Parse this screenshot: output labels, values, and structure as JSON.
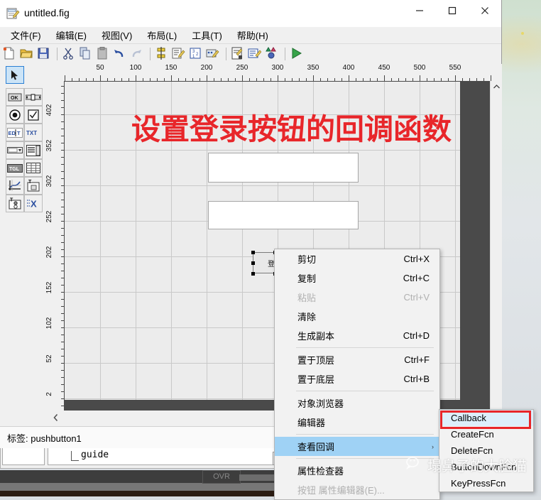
{
  "window": {
    "title": "untitled.fig",
    "icon": "fig-document-icon",
    "controls": {
      "minimize": "minimize-icon",
      "maximize": "maximize-icon",
      "close": "close-icon"
    }
  },
  "menubar": {
    "items": [
      {
        "label": "文件(F)",
        "name": "menu-file"
      },
      {
        "label": "编辑(E)",
        "name": "menu-edit"
      },
      {
        "label": "视图(V)",
        "name": "menu-view"
      },
      {
        "label": "布局(L)",
        "name": "menu-layout"
      },
      {
        "label": "工具(T)",
        "name": "menu-tools"
      },
      {
        "label": "帮助(H)",
        "name": "menu-help"
      }
    ]
  },
  "toolbar": {
    "items": [
      "new-file-icon",
      "open-folder-icon",
      "save-disk-icon",
      "sep",
      "cut-scissors-icon",
      "copy-icon",
      "paste-icon",
      "undo-arrow-icon",
      "redo-arrow-icon",
      "sep",
      "align-objects-icon",
      "menu-editor-icon",
      "tab-order-editor-icon",
      "toolbar-editor-icon",
      "sep",
      "m-file-editor-icon",
      "property-inspector-icon",
      "object-browser-icon",
      "sep",
      "run-figure-icon"
    ]
  },
  "palette": {
    "tools": [
      {
        "name": "select-arrow-tool",
        "glyph": "arrow",
        "selected": true
      },
      {
        "name": "push-button-tool",
        "glyph": "OK",
        "selected": false
      },
      {
        "name": "slider-tool",
        "glyph": "slider",
        "selected": false
      },
      {
        "name": "radio-button-tool",
        "glyph": "radio",
        "selected": false
      },
      {
        "name": "check-box-tool",
        "glyph": "check",
        "selected": false
      },
      {
        "name": "edit-text-tool",
        "glyph": "EDIT",
        "selected": false
      },
      {
        "name": "static-text-tool",
        "glyph": "TXT",
        "selected": false
      },
      {
        "name": "pop-up-menu-tool",
        "glyph": "popup",
        "selected": false
      },
      {
        "name": "list-box-tool",
        "glyph": "listbox",
        "selected": false
      },
      {
        "name": "toggle-button-tool",
        "glyph": "TGL",
        "selected": false
      },
      {
        "name": "table-tool",
        "glyph": "table",
        "selected": false
      },
      {
        "name": "axes-tool",
        "glyph": "axes",
        "selected": false
      },
      {
        "name": "panel-tool",
        "glyph": "panel",
        "selected": false
      },
      {
        "name": "button-group-tool",
        "glyph": "buttongroup",
        "selected": false
      },
      {
        "name": "activex-control-tool",
        "glyph": "activex",
        "selected": false
      }
    ]
  },
  "rulers": {
    "horizontal": [
      "50",
      "100",
      "150",
      "200",
      "250",
      "300",
      "350",
      "400",
      "450",
      "500",
      "550"
    ],
    "vertical": [
      "402",
      "352",
      "302",
      "252",
      "202",
      "152",
      "102",
      "52",
      "2"
    ]
  },
  "canvas": {
    "annotation": "设置登录按钮的回调函数",
    "annotation_color": "#e8262a",
    "push_button_label": "登录",
    "edit_boxes": 2
  },
  "context_menu": {
    "items": [
      {
        "label": "剪切",
        "accel": "Ctrl+X",
        "disabled": false,
        "submenu": false,
        "highlighted": false,
        "name": "ctx-cut"
      },
      {
        "label": "复制",
        "accel": "Ctrl+C",
        "disabled": false,
        "submenu": false,
        "highlighted": false,
        "name": "ctx-copy"
      },
      {
        "label": "粘贴",
        "accel": "Ctrl+V",
        "disabled": true,
        "submenu": false,
        "highlighted": false,
        "name": "ctx-paste"
      },
      {
        "label": "清除",
        "accel": "",
        "disabled": false,
        "submenu": false,
        "highlighted": false,
        "name": "ctx-clear"
      },
      {
        "label": "生成副本",
        "accel": "Ctrl+D",
        "disabled": false,
        "submenu": false,
        "highlighted": false,
        "name": "ctx-duplicate"
      },
      {
        "separator": true
      },
      {
        "label": "置于顶层",
        "accel": "Ctrl+F",
        "disabled": false,
        "submenu": false,
        "highlighted": false,
        "name": "ctx-bring-to-front"
      },
      {
        "label": "置于底层",
        "accel": "Ctrl+B",
        "disabled": false,
        "submenu": false,
        "highlighted": false,
        "name": "ctx-send-to-back"
      },
      {
        "separator": true
      },
      {
        "label": "对象浏览器",
        "accel": "",
        "disabled": false,
        "submenu": false,
        "highlighted": false,
        "name": "ctx-object-browser"
      },
      {
        "label": "编辑器",
        "accel": "",
        "disabled": false,
        "submenu": false,
        "highlighted": false,
        "name": "ctx-editor"
      },
      {
        "separator": true
      },
      {
        "label": "查看回调",
        "accel": "",
        "disabled": false,
        "submenu": true,
        "highlighted": true,
        "name": "ctx-view-callbacks"
      },
      {
        "separator": true
      },
      {
        "label": "属性检查器",
        "accel": "",
        "disabled": false,
        "submenu": false,
        "highlighted": false,
        "name": "ctx-property-inspector"
      },
      {
        "label": "按钮 属性编辑器(E)...",
        "accel": "",
        "disabled": true,
        "submenu": false,
        "highlighted": false,
        "name": "ctx-button-property-editor"
      }
    ]
  },
  "submenu": {
    "items": [
      {
        "label": "Callback",
        "highlighted": true,
        "name": "submenu-callback"
      },
      {
        "label": "CreateFcn",
        "highlighted": false,
        "name": "submenu-createfcn"
      },
      {
        "label": "DeleteFcn",
        "highlighted": false,
        "name": "submenu-deletefcn"
      },
      {
        "label": "ButtonDownFcn",
        "highlighted": false,
        "name": "submenu-buttondownfcn"
      },
      {
        "label": "KeyPressFcn",
        "highlighted": false,
        "name": "submenu-keypressfcn"
      }
    ],
    "highlight_box_color": "#e8262a"
  },
  "statusbar": {
    "text": "标签: pushbutton1"
  },
  "matlab_strip": {
    "command": "guide",
    "overwrite_indicator": "OVR"
  },
  "watermark": {
    "text": "塌鼻子的大脸猫",
    "icon": "wechat-icon"
  },
  "ghost_text": "按钮 属性编辑器"
}
